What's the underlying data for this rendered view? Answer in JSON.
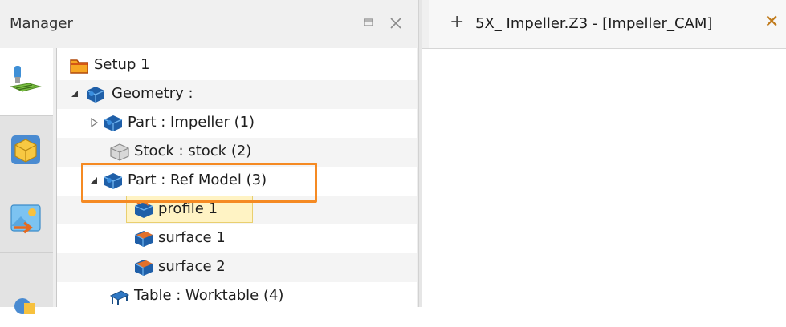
{
  "manager": {
    "title": "Manager",
    "restore_icon": "restore-icon",
    "close_icon": "close-icon"
  },
  "sidebar": {
    "tabs": [
      {
        "icon": "cam-setup-icon",
        "active": true
      },
      {
        "icon": "part-cube-icon",
        "active": false
      },
      {
        "icon": "image-export-icon",
        "active": false
      },
      {
        "icon": "shapes-icon",
        "active": false
      }
    ]
  },
  "tree": {
    "items": [
      {
        "label": "Setup 1",
        "icon": "folder-icon",
        "expander": "none"
      },
      {
        "label": "Geometry :",
        "icon": "geometry-icon",
        "expander": "expanded"
      },
      {
        "label": "Part : Impeller (1)",
        "icon": "part-icon",
        "expander": "collapsed"
      },
      {
        "label": "Stock : stock (2)",
        "icon": "stock-icon",
        "expander": "none"
      },
      {
        "label": "Part : Ref Model (3)",
        "icon": "part-icon",
        "expander": "expanded"
      },
      {
        "label": "profile 1",
        "icon": "profile-icon",
        "expander": "none",
        "selected": true
      },
      {
        "label": "surface 1",
        "icon": "surface-icon",
        "expander": "none"
      },
      {
        "label": "surface 2",
        "icon": "surface-icon",
        "expander": "none"
      },
      {
        "label": "Table : Worktable (4)",
        "icon": "table-icon",
        "expander": "none"
      }
    ]
  },
  "document_tab": {
    "plus_label": "+",
    "title": "5X_ Impeller.Z3 - [Impeller_CAM]",
    "close_label": "✕"
  },
  "colors": {
    "highlight": "#f58a23",
    "selection": "#fff3c4",
    "part_blue": "#1f5fa8",
    "surface_orange": "#e2702a"
  }
}
